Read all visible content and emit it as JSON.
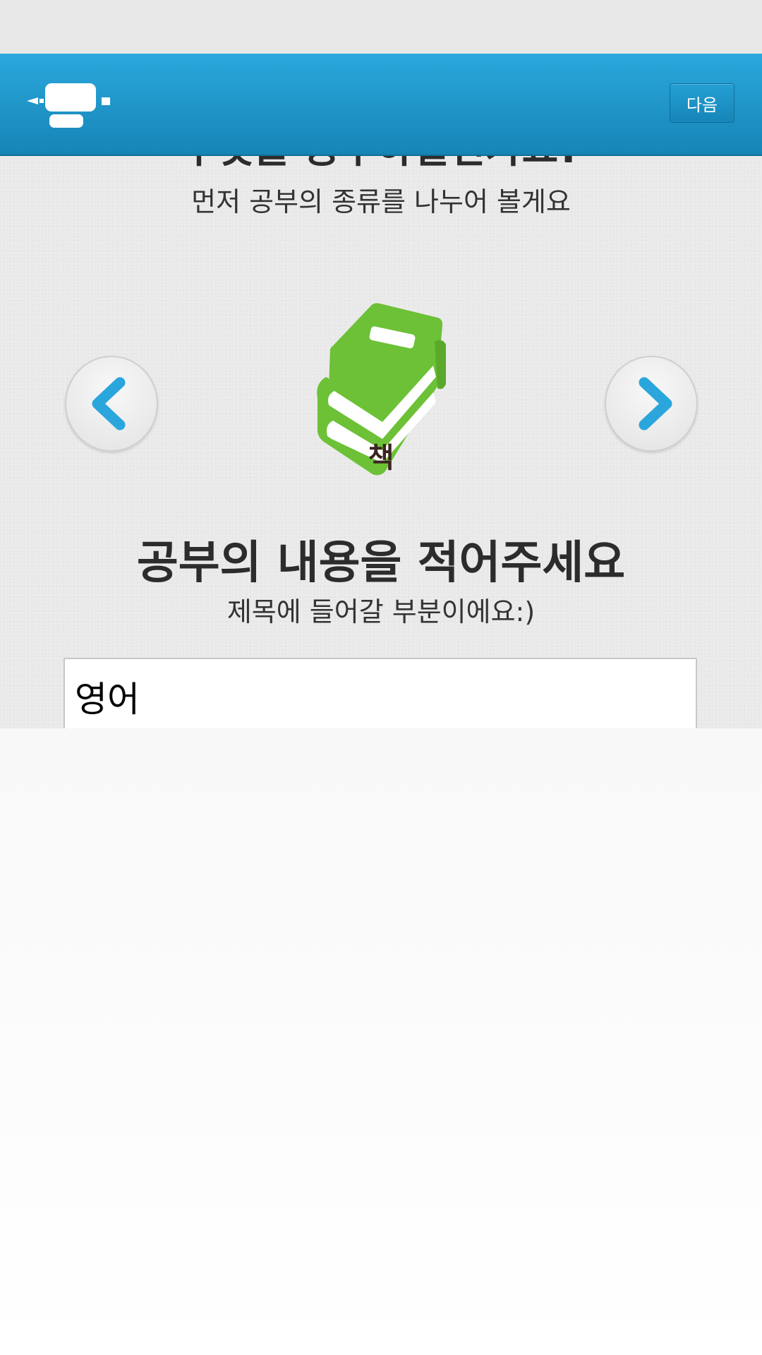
{
  "header": {
    "logo_icon": "studying-desk-icon",
    "next_button_label": "다음"
  },
  "category_section": {
    "title": "무엇을 공부하실건가요?",
    "subtitle": "먼저 공부의 종류를 나누어 볼게요",
    "selected_category": {
      "label": "책",
      "icon": "book-stack-icon"
    },
    "prev_icon": "chevron-left-icon",
    "next_icon": "chevron-right-icon"
  },
  "content_section": {
    "title": "공부의 내용을 적어주세요",
    "subtitle": "제목에 들어갈 부분이에요:)",
    "input_value": "영어"
  },
  "colors": {
    "header_blue": "#1e97cc",
    "accent_blue": "#2aa6dc",
    "book_green": "#6cc136"
  }
}
